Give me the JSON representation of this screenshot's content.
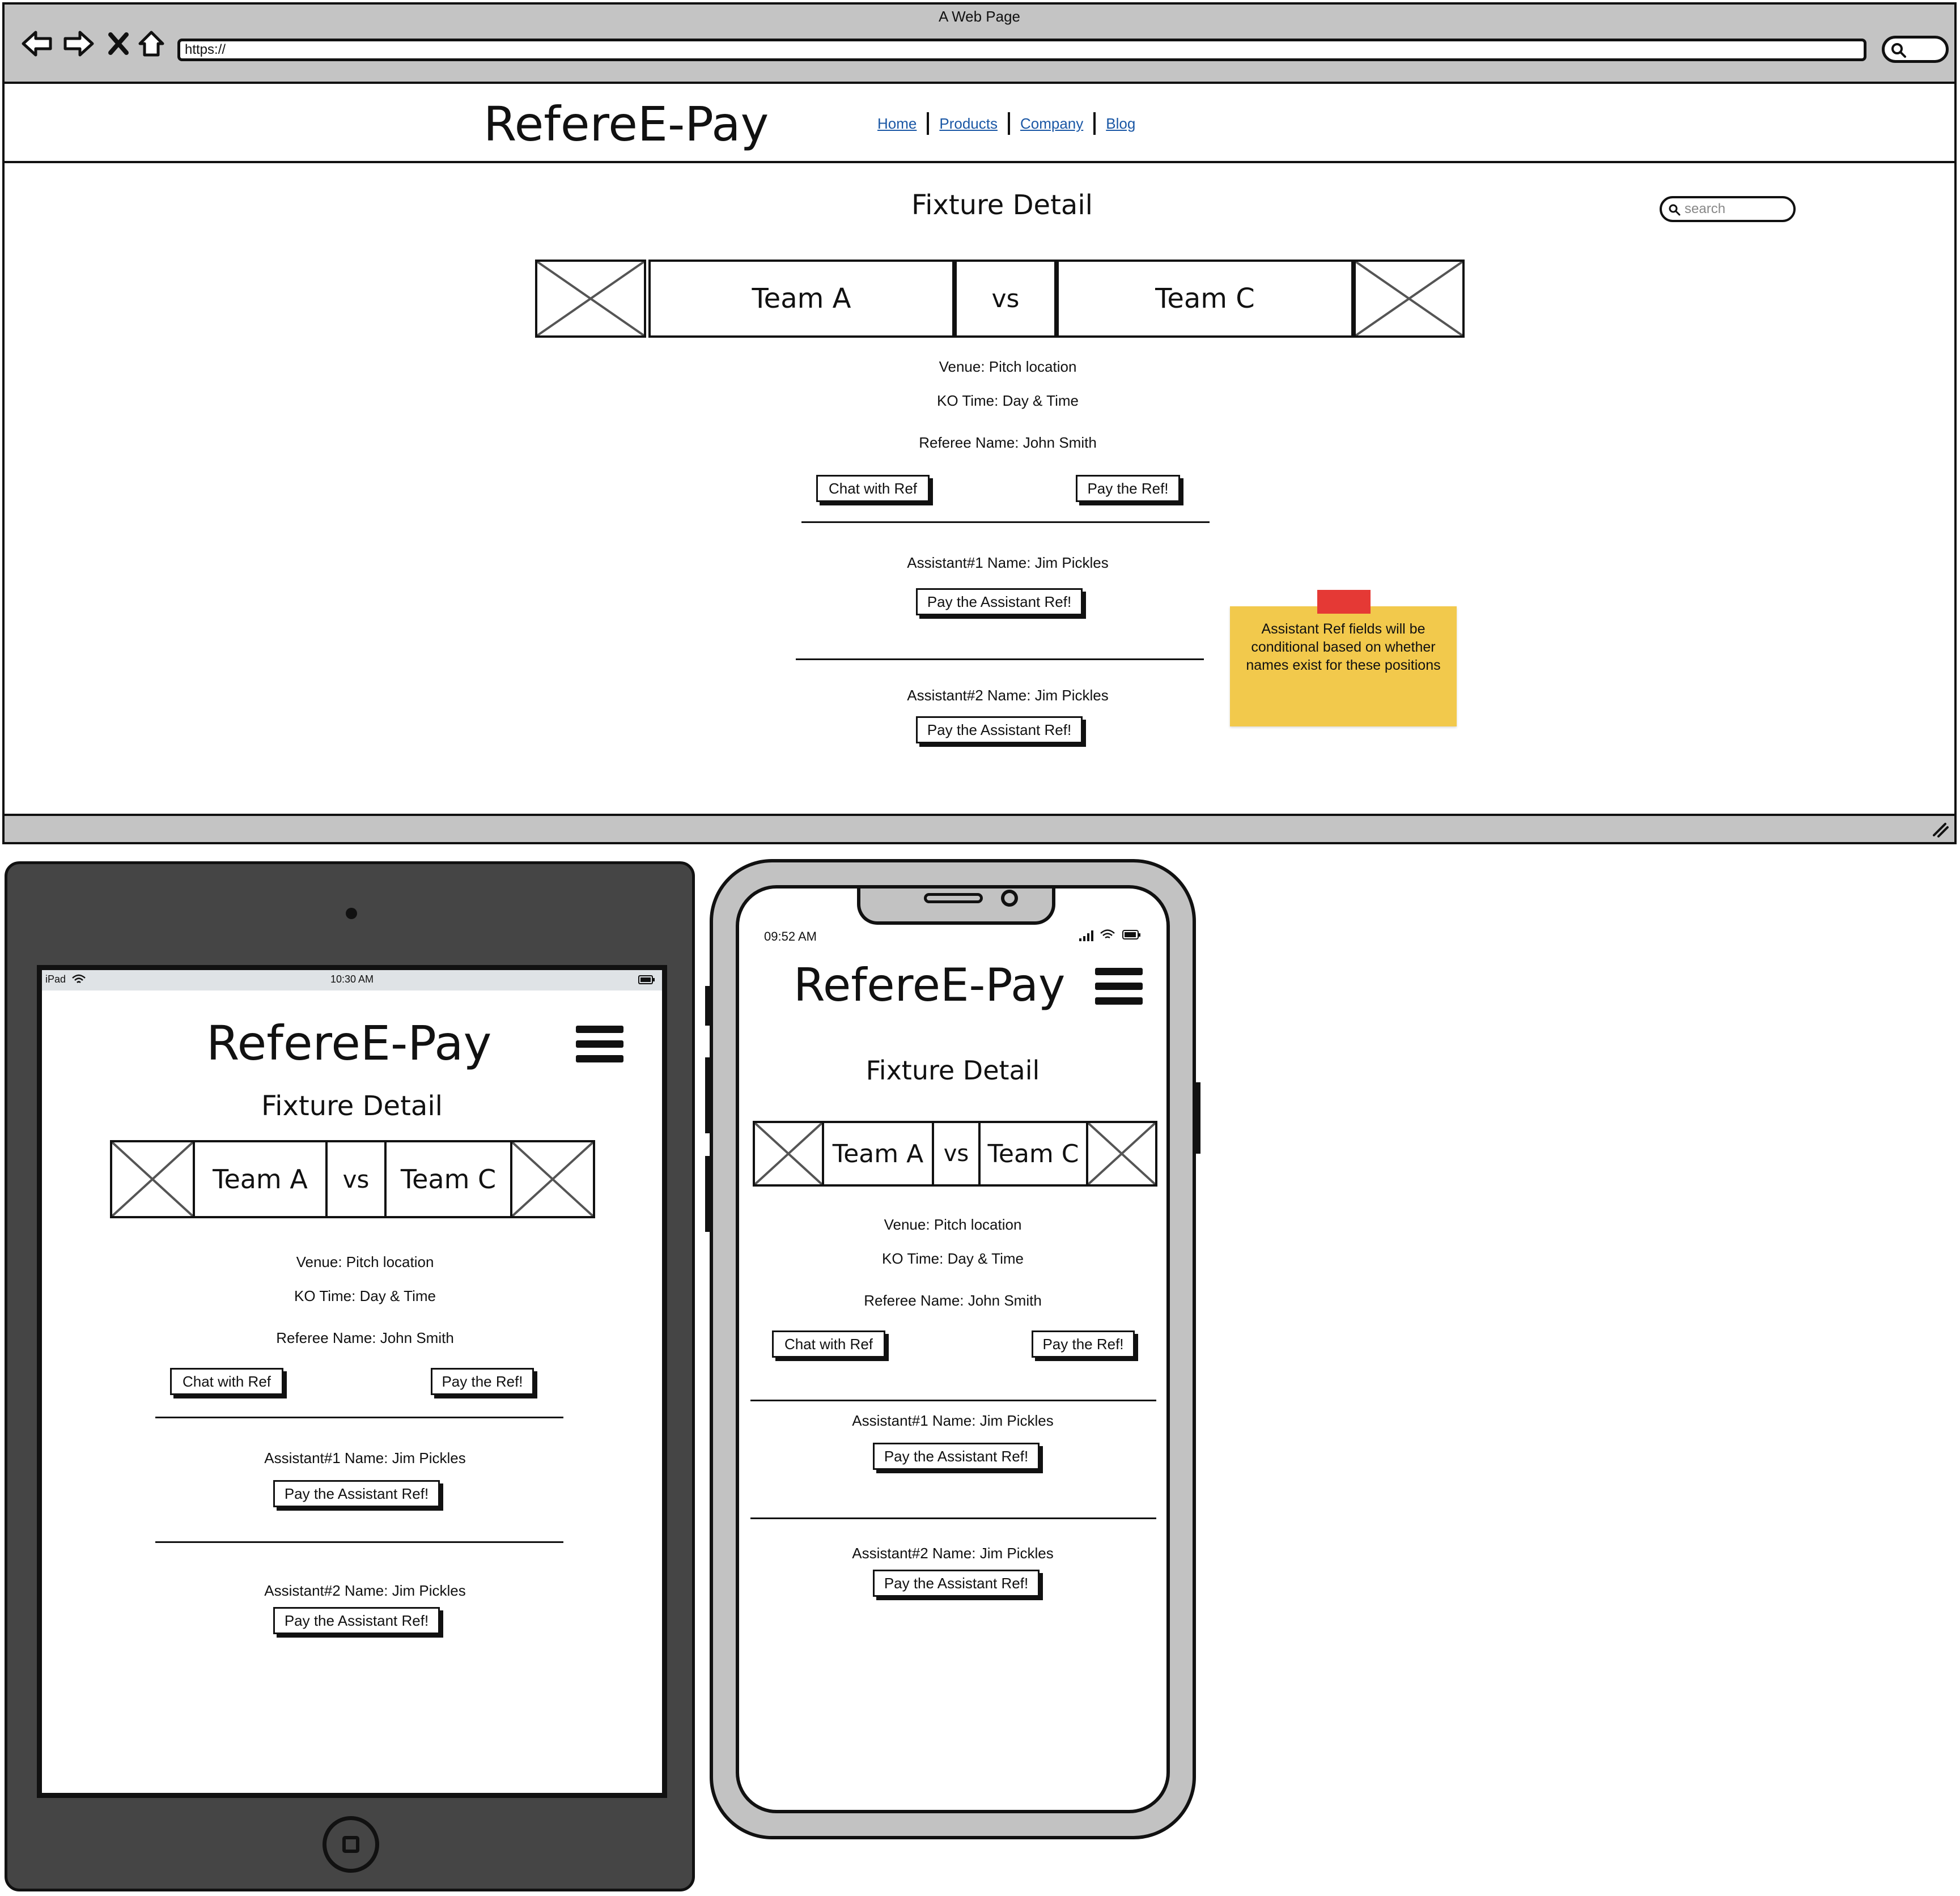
{
  "browser": {
    "title": "A Web Page",
    "url": "https://"
  },
  "site": {
    "logo": "RefereE-Pay",
    "nav": [
      "Home",
      "Products",
      "Company",
      "Blog"
    ],
    "search_placeholder": "search"
  },
  "fixture": {
    "page_title": "Fixture Detail",
    "home_team": "Team A",
    "vs": "vs",
    "away_team": "Team C",
    "venue": "Venue: Pitch location",
    "ko_time": "KO Time: Day & Time",
    "referee": "Referee Name: John Smith",
    "chat_button": "Chat with Ref",
    "pay_ref_button": "Pay the Ref!",
    "assistant1": "Assistant#1 Name: Jim Pickles",
    "assistant2": "Assistant#2 Name: Jim Pickles",
    "pay_assistant_button": "Pay the Assistant Ref!"
  },
  "sticky_note": "Assistant Ref fields will be conditional based on whether names exist for these positions",
  "tablet": {
    "carrier": "iPad",
    "time": "10:30 AM"
  },
  "phone": {
    "time": "09:52 AM"
  },
  "colors": {
    "chrome_gray": "#c4c4c4",
    "link_blue": "#1a57a5",
    "sticky_yellow": "#f2c94c",
    "tape_red": "#e53935",
    "tablet_body": "#454545"
  }
}
